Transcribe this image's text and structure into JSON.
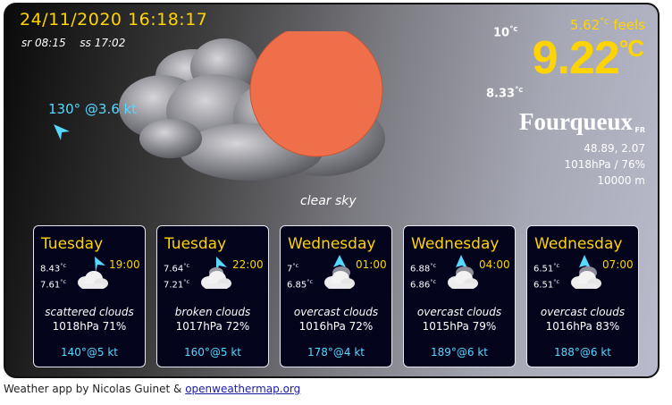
{
  "current": {
    "datetime": "24/11/2020 16:18:17",
    "sunrise": "sr 08:15",
    "sunset": "ss 17:02",
    "wind": "130° @3.6 kt",
    "description": "clear sky",
    "temp_max": "10",
    "temp_min": "8.33",
    "feels": "5.62",
    "feels_suffix": "feels",
    "temp": "9.22",
    "deg_unit": "°c",
    "deg_unit_big": "°C",
    "city": "Fourqueux",
    "country": "FR",
    "coords": "48.89, 2.07",
    "pressure_humidity": "1018hPa / 76%",
    "visibility": "10000 m",
    "icons": [
      "cloud-icon",
      "sun-icon",
      "wind-direction-icon"
    ]
  },
  "forecast": [
    {
      "day": "Tuesday",
      "hi": "8.43",
      "lo": "7.61",
      "time": "19:00",
      "desc": "scattered clouds",
      "pressure_humidity": "1018hPa  71%",
      "wind": "140°@5 kt"
    },
    {
      "day": "Tuesday",
      "hi": "7.64",
      "lo": "7.21",
      "time": "22:00",
      "desc": "broken clouds",
      "pressure_humidity": "1017hPa  72%",
      "wind": "160°@5 kt"
    },
    {
      "day": "Wednesday",
      "hi": "7",
      "lo": "6.85",
      "time": "01:00",
      "desc": "overcast clouds",
      "pressure_humidity": "1016hPa  72%",
      "wind": "178°@4 kt"
    },
    {
      "day": "Wednesday",
      "hi": "6.88",
      "lo": "6.86",
      "time": "04:00",
      "desc": "overcast clouds",
      "pressure_humidity": "1015hPa  79%",
      "wind": "189°@6 kt"
    },
    {
      "day": "Wednesday",
      "hi": "6.51",
      "lo": "6.51",
      "time": "07:00",
      "desc": "overcast clouds",
      "pressure_humidity": "1016hPa  83%",
      "wind": "188°@6 kt"
    }
  ],
  "footer": {
    "text": "Weather app by Nicolas Guinet & ",
    "link": "openweathermap.org"
  },
  "colors": {
    "accent": "#ffd400",
    "wind": "#56d8ff",
    "sun": "#ee6f4a",
    "card_bg": "#03031c"
  }
}
